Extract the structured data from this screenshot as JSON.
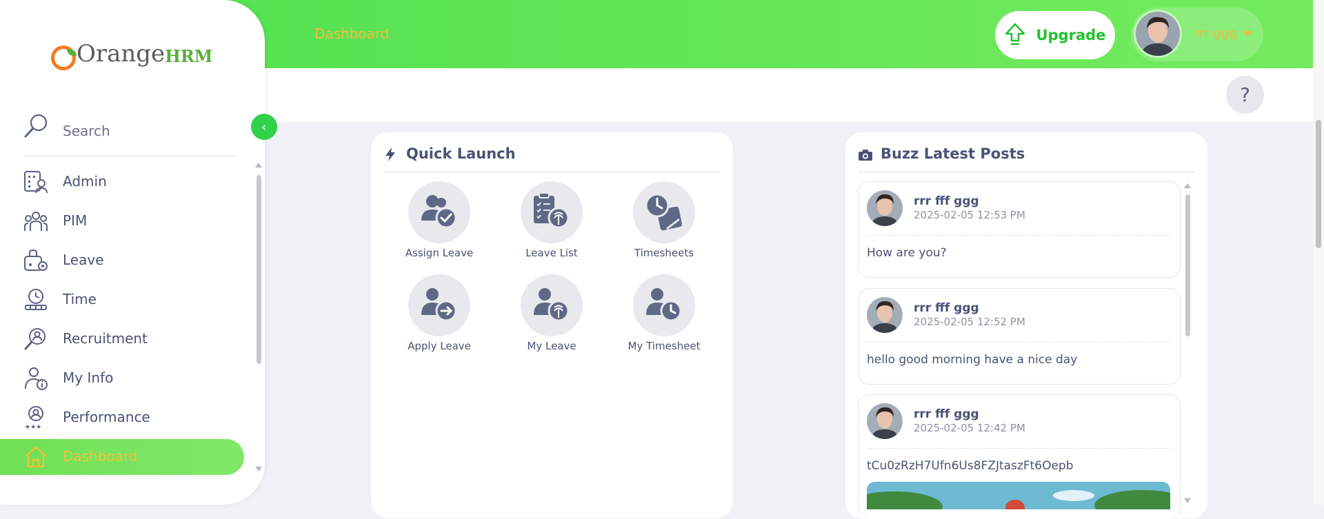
{
  "app": {
    "logo_text_main": "Orange",
    "logo_text_suffix": "HRM"
  },
  "topbar": {
    "title": "Dashboard",
    "upgrade_label": "Upgrade",
    "user_name": "rrr ggg",
    "help_label": "?"
  },
  "sidebar": {
    "search_label": "Search",
    "collapse_label": "‹",
    "items": [
      {
        "label": "Admin",
        "icon": "admin-icon"
      },
      {
        "label": "PIM",
        "icon": "pim-icon"
      },
      {
        "label": "Leave",
        "icon": "leave-icon"
      },
      {
        "label": "Time",
        "icon": "time-icon"
      },
      {
        "label": "Recruitment",
        "icon": "recruitment-icon"
      },
      {
        "label": "My Info",
        "icon": "my-info-icon"
      },
      {
        "label": "Performance",
        "icon": "performance-icon"
      },
      {
        "label": "Dashboard",
        "icon": "home-icon",
        "active": true
      }
    ]
  },
  "quick_launch": {
    "title": "Quick Launch",
    "items": [
      {
        "label": "Assign Leave",
        "icon": "assign-leave-icon"
      },
      {
        "label": "Leave List",
        "icon": "leave-list-icon"
      },
      {
        "label": "Timesheets",
        "icon": "timesheets-icon"
      },
      {
        "label": "Apply Leave",
        "icon": "apply-leave-icon"
      },
      {
        "label": "My Leave",
        "icon": "my-leave-icon"
      },
      {
        "label": "My Timesheet",
        "icon": "my-timesheet-icon"
      }
    ]
  },
  "buzz": {
    "title": "Buzz Latest Posts",
    "posts": [
      {
        "author": "rrr fff ggg",
        "time": "2025-02-05 12:53 PM",
        "text": "How are you?"
      },
      {
        "author": "rrr fff ggg",
        "time": "2025-02-05 12:52 PM",
        "text": "hello good morning have a nice day"
      },
      {
        "author": "rrr fff ggg",
        "time": "2025-02-05 12:42 PM",
        "text": "tCu0zRzH7Ufn6Us8FZJtaszFt6Oepb"
      }
    ]
  },
  "colors": {
    "brand_green": "#4fe04f",
    "accent_orange": "#f5b840",
    "text_primary": "#4a5275"
  }
}
